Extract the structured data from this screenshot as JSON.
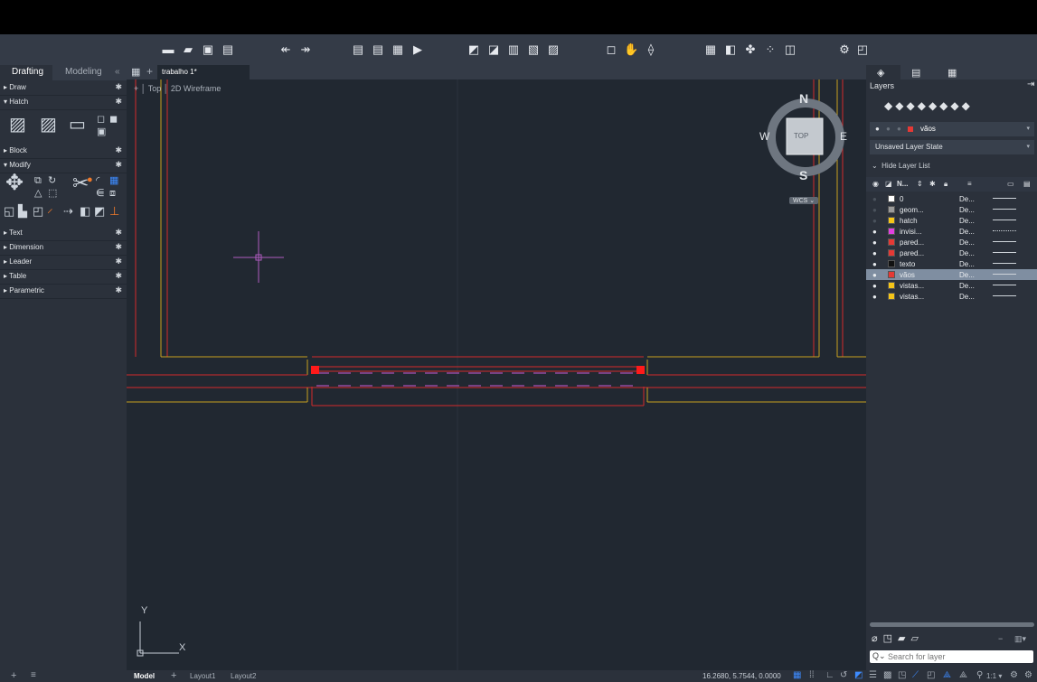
{
  "palette": {
    "tabs": [
      "Drafting",
      "Modeling"
    ],
    "collapse": "«",
    "sections": [
      "Draw",
      "Hatch",
      "Block",
      "Modify",
      "Text",
      "Dimension",
      "Leader",
      "Table",
      "Parametric"
    ]
  },
  "document": {
    "tab_title": "trabalho 1*",
    "add_tab": "+",
    "view_label_1": "Top",
    "view_label_2": "2D Wireframe",
    "viewcube": {
      "n": "N",
      "s": "S",
      "e": "E",
      "w": "W",
      "face": "TOP",
      "ucs": "WCS"
    },
    "axis_x": "X",
    "axis_y": "Y"
  },
  "layers_panel": {
    "title": "Layers",
    "current_layer": "vãos",
    "layer_state": "Unsaved Layer State",
    "hide_list": "Hide Layer List",
    "header_name": "N...",
    "search_placeholder": "Search for layer",
    "layers": [
      {
        "name": "0",
        "color": "#ffffff",
        "ltype": "De...",
        "visible": false
      },
      {
        "name": "geom...",
        "color": "#9a9a9a",
        "ltype": "De...",
        "visible": false
      },
      {
        "name": "hatch",
        "color": "#f5c518",
        "ltype": "De...",
        "visible": false
      },
      {
        "name": "invisi...",
        "color": "#e040e0",
        "ltype": "De...",
        "visible": true
      },
      {
        "name": "pared...",
        "color": "#e53935",
        "ltype": "De...",
        "visible": true
      },
      {
        "name": "pared...",
        "color": "#e53935",
        "ltype": "De...",
        "visible": true
      },
      {
        "name": "texto",
        "color": "#111111",
        "ltype": "De...",
        "visible": true
      },
      {
        "name": "vãos",
        "color": "#e53935",
        "ltype": "De...",
        "visible": true,
        "selected": true
      },
      {
        "name": "vistas...",
        "color": "#f5c518",
        "ltype": "De...",
        "visible": true
      },
      {
        "name": "vistas...",
        "color": "#f5c518",
        "ltype": "De...",
        "visible": true
      }
    ]
  },
  "status": {
    "tabs": [
      "Model",
      "Layout1",
      "Layout2"
    ],
    "add": "+",
    "coords": "16.2680, 5.7544, 0.0000",
    "scale": "1:1"
  }
}
